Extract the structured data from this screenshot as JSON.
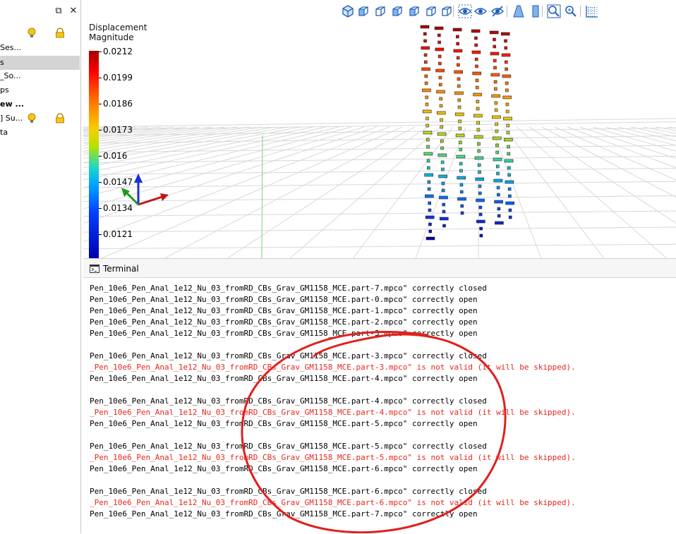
{
  "left_panel": {
    "restore_icon": "restore-window-icon",
    "close_icon": "close-icon",
    "rows": [
      {
        "label": "",
        "icons": [
          "lightbulb-icon",
          "lock-icon"
        ],
        "selected": false,
        "bold": false
      },
      {
        "label": "Ses...",
        "icons": [],
        "selected": false,
        "bold": false
      },
      {
        "label": "s",
        "icons": [],
        "selected": true,
        "bold": false
      },
      {
        "label": "_So...",
        "icons": [],
        "selected": false,
        "bold": false
      },
      {
        "label": "ps",
        "icons": [],
        "selected": false,
        "bold": false
      },
      {
        "label": "ew ...",
        "icons": [],
        "selected": false,
        "bold": true
      },
      {
        "label": "] Su...",
        "icons": [
          "lightbulb-icon",
          "lock-icon"
        ],
        "selected": false,
        "bold": false
      },
      {
        "label": "ta",
        "icons": [],
        "selected": false,
        "bold": false
      }
    ]
  },
  "toolbar": {
    "buttons": [
      "iso-view-icon",
      "front-view-icon",
      "back-view-icon",
      "left-view-icon",
      "right-view-icon",
      "top-view-icon",
      "bottom-view-icon",
      "show-hide-icon",
      "show-only-icon",
      "hide-icon",
      "perspective-icon",
      "parallel-icon",
      "zoom-fit-icon",
      "zoom-region-icon",
      "grid-icon"
    ]
  },
  "legend": {
    "title_line1": "Displacement",
    "title_line2": "Magnitude",
    "ticks": [
      "0.0212",
      "0.0199",
      "0.0186",
      "0.0173",
      "0.016",
      "0.0147",
      "0.0134",
      "0.0121"
    ],
    "colors": {
      "max": "#a50000",
      "min": "#0000b0"
    }
  },
  "terminal": {
    "title": "Terminal",
    "icon": "terminal-icon",
    "lines": [
      {
        "text": "Pen_10e6_Pen_Anal_1e12_Nu_03_fromRD_CBs_Grav_GM1158_MCE.part-7.mpco\" correctly closed",
        "error": false
      },
      {
        "text": "Pen_10e6_Pen_Anal_1e12_Nu_03_fromRD_CBs_Grav_GM1158_MCE.part-0.mpco\" correctly open",
        "error": false
      },
      {
        "text": "Pen_10e6_Pen_Anal_1e12_Nu_03_fromRD_CBs_Grav_GM1158_MCE.part-1.mpco\" correctly open",
        "error": false
      },
      {
        "text": "Pen_10e6_Pen_Anal_1e12_Nu_03_fromRD_CBs_Grav_GM1158_MCE.part-2.mpco\" correctly open",
        "error": false
      },
      {
        "text": "Pen_10e6_Pen_Anal_1e12_Nu_03_fromRD_CBs_Grav_GM1158_MCE.part-3.mpco\" correctly open",
        "error": false
      },
      {
        "text": "",
        "error": false
      },
      {
        "text": "Pen_10e6_Pen_Anal_1e12_Nu_03_fromRD_CBs_Grav_GM1158_MCE.part-3.mpco\" correctly closed",
        "error": false
      },
      {
        "text": "_Pen_10e6_Pen_Anal_1e12_Nu_03_fromRD_CBs_Grav_GM1158_MCE.part-3.mpco\" is not valid (it will be skipped).",
        "error": true
      },
      {
        "text": "Pen_10e6_Pen_Anal_1e12_Nu_03_fromRD_CBs_Grav_GM1158_MCE.part-4.mpco\" correctly open",
        "error": false
      },
      {
        "text": "",
        "error": false
      },
      {
        "text": "Pen_10e6_Pen_Anal_1e12_Nu_03_fromRD_CBs_Grav_GM1158_MCE.part-4.mpco\" correctly closed",
        "error": false
      },
      {
        "text": "_Pen_10e6_Pen_Anal_1e12_Nu_03_fromRD_CBs_Grav_GM1158_MCE.part-4.mpco\" is not valid (it will be skipped).",
        "error": true
      },
      {
        "text": "Pen_10e6_Pen_Anal_1e12_Nu_03_fromRD_CBs_Grav_GM1158_MCE.part-5.mpco\" correctly open",
        "error": false
      },
      {
        "text": "",
        "error": false
      },
      {
        "text": "Pen_10e6_Pen_Anal_1e12_Nu_03_fromRD_CBs_Grav_GM1158_MCE.part-5.mpco\" correctly closed",
        "error": false
      },
      {
        "text": "_Pen_10e6_Pen_Anal_1e12_Nu_03_fromRD_CBs_Grav_GM1158_MCE.part-5.mpco\" is not valid (it will be skipped).",
        "error": true
      },
      {
        "text": "Pen_10e6_Pen_Anal_1e12_Nu_03_fromRD_CBs_Grav_GM1158_MCE.part-6.mpco\" correctly open",
        "error": false
      },
      {
        "text": "",
        "error": false
      },
      {
        "text": "Pen_10e6_Pen_Anal_1e12_Nu_03_fromRD_CBs_Grav_GM1158_MCE.part-6.mpco\" correctly closed",
        "error": false
      },
      {
        "text": "_Pen_10e6_Pen_Anal_1e12_Nu_03_fromRD_CBs_Grav_GM1158_MCE.part-6.mpco\" is not valid (it will be skipped).",
        "error": true
      },
      {
        "text": "Pen_10e6_Pen_Anal_1e12_Nu_03_fromRD_CBs_Grav_GM1158_MCE.part-7.mpco\" correctly open",
        "error": false
      }
    ]
  },
  "colors": {
    "error_text": "#e8261c",
    "annotation": "#e0201c",
    "selection": "#d4d4d4"
  }
}
